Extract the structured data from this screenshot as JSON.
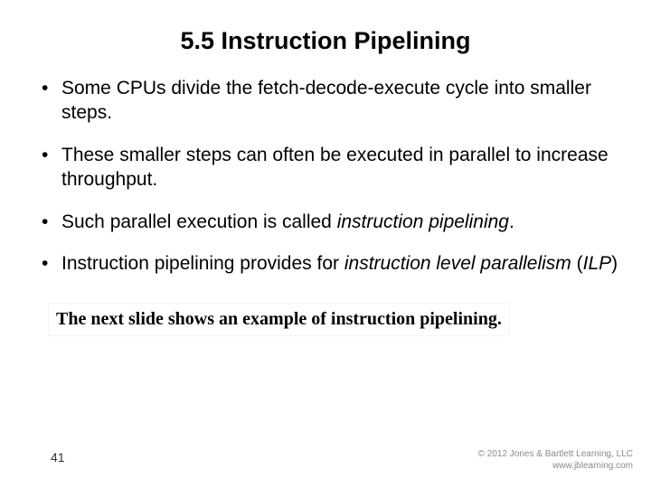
{
  "title": "5.5 Instruction Pipelining",
  "bullets": [
    {
      "pre": "Some CPUs divide the fetch-decode-execute cycle into smaller steps.",
      "it1": "",
      "mid": "",
      "it2": "",
      "post": ""
    },
    {
      "pre": "These smaller steps can often be executed in parallel to increase throughput.",
      "it1": "",
      "mid": "",
      "it2": "",
      "post": ""
    },
    {
      "pre": "Such parallel execution is called ",
      "it1": "instruction pipelining",
      "mid": "",
      "it2": "",
      "post": "."
    },
    {
      "pre": "Instruction pipelining provides for ",
      "it1": "instruction level parallelism",
      "mid": " (",
      "it2": "ILP",
      "post": ")"
    }
  ],
  "note": "The next slide shows an example of instruction pipelining.",
  "page_number": "41",
  "copyright_line1": "© 2012 Jones & Bartlett Learning, LLC",
  "copyright_line2": "www.jblearning.com"
}
